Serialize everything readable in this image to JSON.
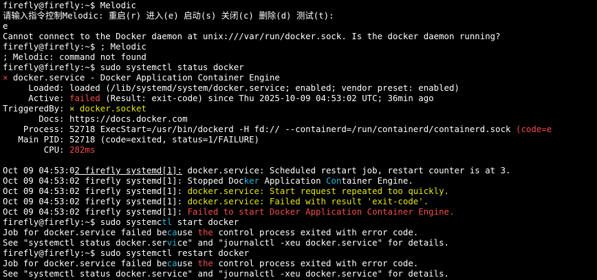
{
  "terminal": {
    "lines": [
      {
        "segments": [
          {
            "text": "firefly@firefly:~$ Melodic",
            "color": "w"
          }
        ]
      },
      {
        "segments": [
          {
            "text": "请输入指令控制Melodic: 重启(r) 进入(e) 启动(s) 关闭(c) 删除(d) 测试(t):",
            "color": "w"
          }
        ]
      },
      {
        "segments": [
          {
            "text": "e",
            "color": "w"
          }
        ]
      },
      {
        "segments": [
          {
            "text": "Cannot connect to the Docker daemon at unix:///var/run/docker.sock. Is the docker daemon running?",
            "color": "w"
          }
        ]
      },
      {
        "segments": [
          {
            "text": "firefly@firefly:~$ ; Melodic",
            "color": "w"
          }
        ]
      },
      {
        "segments": [
          {
            "text": "; Melodic: command not found",
            "color": "w"
          }
        ]
      },
      {
        "segments": [
          {
            "text": "firefly@firefly:~$ sudo systemctl status docker",
            "color": "w"
          }
        ]
      },
      {
        "segments": [
          {
            "text": "× ",
            "color": "red"
          },
          {
            "text": "docker.service - Docker Application Container Engine",
            "color": "w"
          }
        ]
      },
      {
        "segments": [
          {
            "text": "     Loaded: loaded (/lib/systemd/system/docker.service; enabled; vendor preset: enabled)",
            "color": "w"
          }
        ]
      },
      {
        "segments": [
          {
            "text": "     Active: ",
            "color": "w"
          },
          {
            "text": "failed",
            "color": "red"
          },
          {
            "text": " (Result: exit-code) since Thu 2025-10-09 04:53:02 UTC; 36min ago",
            "color": "w"
          }
        ]
      },
      {
        "segments": [
          {
            "text": "TriggeredBy: ",
            "color": "w"
          },
          {
            "text": "× docker.socket",
            "color": "yellow"
          }
        ]
      },
      {
        "segments": [
          {
            "text": "       Docs: https://docs.docker.com",
            "color": "w"
          }
        ]
      },
      {
        "segments": [
          {
            "text": "    Process: 52718 ExecStart=/usr/bin/dockerd -H fd:// --containerd=/run/containerd/containerd.sock ",
            "color": "w"
          },
          {
            "text": "(code=e",
            "color": "red"
          }
        ]
      },
      {
        "segments": [
          {
            "text": "   Main PID: 52718 (code=exited, status=1/FAILURE)",
            "color": "w"
          }
        ]
      },
      {
        "segments": [
          {
            "text": "        CPU: ",
            "color": "w"
          },
          {
            "text": "282ms",
            "color": "red"
          }
        ]
      },
      {
        "segments": []
      },
      {
        "segments": [
          {
            "text": "Oct 09 04:53:0",
            "color": "w"
          },
          {
            "text": "2 firefly systemd[1]:",
            "color": "w",
            "underline": true
          },
          {
            "text": " docker.service: Scheduled restart job, restart counter is at 3.",
            "color": "w"
          }
        ]
      },
      {
        "segments": [
          {
            "text": "Oct 09 04:53:02 firefly systemd[1]: Stopped Doc",
            "color": "w"
          },
          {
            "text": "ker",
            "color": "cyan"
          },
          {
            "text": " Application ",
            "color": "w"
          },
          {
            "text": "Con",
            "color": "cyan"
          },
          {
            "text": "tainer Engine.",
            "color": "w"
          }
        ]
      },
      {
        "segments": [
          {
            "text": "Oct 09 04:53:02 firefly systemd[1]: ",
            "color": "w"
          },
          {
            "text": "docker.service: Start request repeated too quickly.",
            "color": "yellow"
          }
        ]
      },
      {
        "segments": [
          {
            "text": "Oct 09 04:53:02 firefly systemd[1]: ",
            "color": "w"
          },
          {
            "text": "docker.service: Failed with result 'exit-code'.",
            "color": "yellow"
          }
        ]
      },
      {
        "segments": [
          {
            "text": "Oct 09 04:53:02 firefly systemd[1]: ",
            "color": "w"
          },
          {
            "text": "Failed to start Docker Application Container Engine.",
            "color": "red"
          }
        ]
      },
      {
        "segments": [
          {
            "text": "firefly@firefly:~$ sudo systemc",
            "color": "w"
          },
          {
            "text": "tl",
            "color": "cyan"
          },
          {
            "text": " start docker",
            "color": "w"
          }
        ]
      },
      {
        "segments": [
          {
            "text": "Job for docker.service failed be",
            "color": "w"
          },
          {
            "text": "ca",
            "color": "cyan"
          },
          {
            "text": "use ",
            "color": "w"
          },
          {
            "text": "the",
            "color": "red"
          },
          {
            "text": " control process exited with error code.",
            "color": "w"
          }
        ]
      },
      {
        "segments": [
          {
            "text": "See \"systemctl status docker.ser",
            "color": "w"
          },
          {
            "text": "vi",
            "color": "cyan"
          },
          {
            "text": "ce\" and \"journalctl -xeu docker.service\" for details.",
            "color": "w"
          }
        ]
      },
      {
        "segments": [
          {
            "text": "firefly@firefly:~$ sudo systemctl restart docker",
            "color": "w"
          }
        ]
      },
      {
        "segments": [
          {
            "text": "Job for docker.service failed be",
            "color": "w"
          },
          {
            "text": "ca",
            "color": "cyan"
          },
          {
            "text": "use ",
            "color": "w"
          },
          {
            "text": "the",
            "color": "red"
          },
          {
            "text": " control process exited with error code.",
            "color": "w"
          }
        ]
      },
      {
        "segments": [
          {
            "text": "See \"systemctl status docker.service\" and \"journalctl -xeu docker.service\" for details.",
            "color": "w"
          }
        ]
      }
    ]
  }
}
